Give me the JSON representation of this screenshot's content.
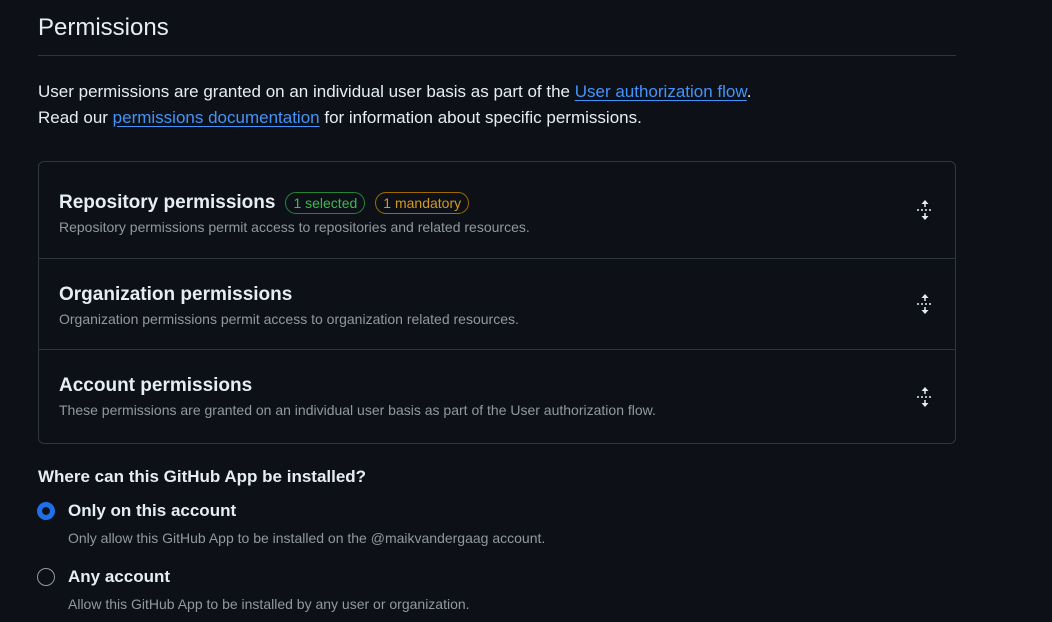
{
  "section": {
    "title": "Permissions"
  },
  "intro": {
    "line1_prefix": "User permissions are granted on an individual user basis as part of the ",
    "line1_link": "User authorization flow",
    "line1_suffix": ".",
    "line2_prefix": "Read our ",
    "line2_link": "permissions documentation",
    "line2_suffix": " for information about specific permissions."
  },
  "permissions": [
    {
      "title": "Repository permissions",
      "description": "Repository permissions permit access to repositories and related resources.",
      "badges": [
        {
          "label": "1 selected",
          "color": "#3fb950"
        },
        {
          "label": "1 mandatory",
          "color": "#d29922"
        }
      ],
      "icon": "unfold-icon"
    },
    {
      "title": "Organization permissions",
      "description": "Organization permissions permit access to organization related resources.",
      "icon": "unfold-icon"
    },
    {
      "title": "Account permissions",
      "description": "These permissions are granted on an individual user basis as part of the User authorization flow.",
      "icon": "unfold-icon"
    }
  ],
  "install": {
    "question": "Where can this GitHub App be installed?",
    "options": [
      {
        "label": "Only on this account",
        "description": "Only allow this GitHub App to be installed on the @maikvandergaag account.",
        "selected": true
      },
      {
        "label": "Any account",
        "description": "Allow this GitHub App to be installed by any user or organization.",
        "selected": false
      }
    ]
  },
  "colors": {
    "background": "#0d1117",
    "border": "#30363d",
    "text": "#e6edf3",
    "muted": "#9198a1",
    "link": "#4493f8",
    "accent": "#1f6feb"
  }
}
